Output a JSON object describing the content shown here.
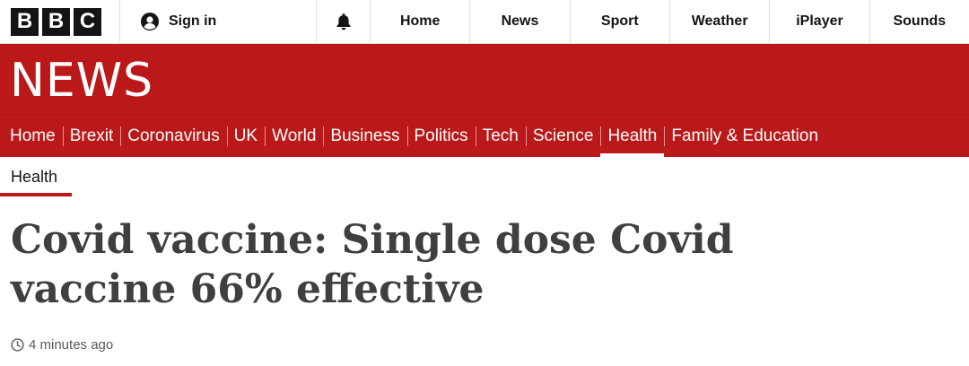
{
  "topbar": {
    "logo_letters": [
      "B",
      "B",
      "C"
    ],
    "signin_label": "Sign in",
    "nav": [
      {
        "label": "Home"
      },
      {
        "label": "News"
      },
      {
        "label": "Sport"
      },
      {
        "label": "Weather"
      },
      {
        "label": "iPlayer"
      },
      {
        "label": "Sounds"
      }
    ]
  },
  "masthead": {
    "wordmark": "NEWS",
    "nav": [
      {
        "label": "Home",
        "active": false
      },
      {
        "label": "Brexit",
        "active": false
      },
      {
        "label": "Coronavirus",
        "active": false
      },
      {
        "label": "UK",
        "active": false
      },
      {
        "label": "World",
        "active": false
      },
      {
        "label": "Business",
        "active": false
      },
      {
        "label": "Politics",
        "active": false
      },
      {
        "label": "Tech",
        "active": false
      },
      {
        "label": "Science",
        "active": false
      },
      {
        "label": "Health",
        "active": true
      },
      {
        "label": "Family & Education",
        "active": false
      }
    ]
  },
  "article": {
    "section": "Health",
    "headline": "Covid vaccine: Single dose Covid vaccine 66% effective",
    "timestamp": "4 minutes ago"
  },
  "colors": {
    "brand_red": "#bb1919",
    "headline_text": "#3f3f42"
  },
  "icons": {
    "signin": "user-circle-icon",
    "notifications": "bell-icon",
    "timestamp": "clock-icon"
  }
}
